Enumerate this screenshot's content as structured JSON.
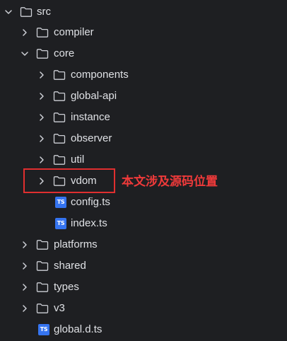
{
  "tree": {
    "src": {
      "label": "src",
      "expanded": true
    },
    "compiler": {
      "label": "compiler",
      "expanded": false
    },
    "core": {
      "label": "core",
      "expanded": true
    },
    "components": {
      "label": "components",
      "expanded": false
    },
    "global_api": {
      "label": "global-api",
      "expanded": false
    },
    "instance": {
      "label": "instance",
      "expanded": false
    },
    "observer": {
      "label": "observer",
      "expanded": false
    },
    "util": {
      "label": "util",
      "expanded": false
    },
    "vdom": {
      "label": "vdom",
      "expanded": false
    },
    "config_ts": {
      "label": "config.ts",
      "badge": "TS"
    },
    "index_ts": {
      "label": "index.ts",
      "badge": "TS"
    },
    "platforms": {
      "label": "platforms",
      "expanded": false
    },
    "shared": {
      "label": "shared",
      "expanded": false
    },
    "types": {
      "label": "types",
      "expanded": false
    },
    "v3": {
      "label": "v3",
      "expanded": false
    },
    "global_d_ts": {
      "label": "global.d.ts",
      "badge": "TS"
    }
  },
  "annotation": {
    "text": "本文涉及源码位置",
    "color": "#e02f2f"
  },
  "colors": {
    "background": "#1e1f22",
    "text": "#dfe1e5",
    "icon": "#ced0d6",
    "ts_badge": "#3574f0"
  }
}
